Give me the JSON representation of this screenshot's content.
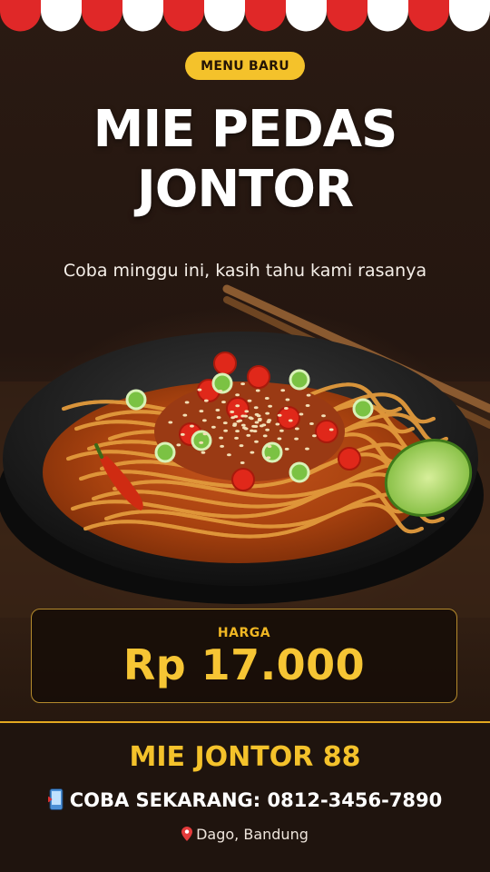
{
  "badge": {
    "label": "MENU BARU"
  },
  "title": {
    "line1": "MIE PEDAS",
    "line2": "JONTOR"
  },
  "subtitle": "Coba minggu ini, kasih tahu kami rasanya",
  "price": {
    "label": "HARGA",
    "value": "Rp 17.000"
  },
  "footer": {
    "brand": "MIE JONTOR 88",
    "cta": "COBA SEKARANG: 0812-3456-7890",
    "location": "Dago, Bandung"
  },
  "icons": {
    "phone": "mobile-phone-icon",
    "location": "location-pin-icon"
  },
  "colors": {
    "accent": "#f4c22b",
    "awning_red": "#e02828",
    "background": "#24160f"
  }
}
